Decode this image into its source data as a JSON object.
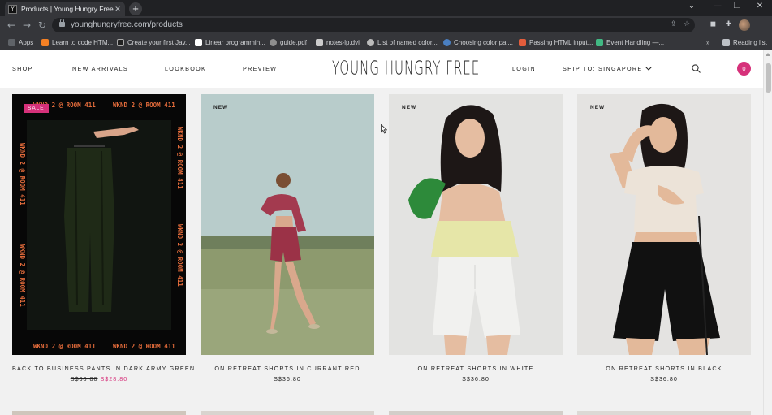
{
  "browser": {
    "tab_title": "Products | Young Hungry Free",
    "tab_close": "✕",
    "new_tab": "+",
    "url": "younghungryfree.com/products",
    "window_controls": [
      "⌄",
      "—",
      "❐",
      "✕"
    ],
    "bookmarks": [
      {
        "label": "Apps",
        "color": "#5f6368"
      },
      {
        "label": "Learn to code HTM...",
        "color": "#f48024"
      },
      {
        "label": "Create your first Jav...",
        "color": "#222222"
      },
      {
        "label": "Linear programmin...",
        "color": "#ffffff"
      },
      {
        "label": "guide.pdf",
        "color": "#8e8e8e"
      },
      {
        "label": "notes-lp.dvi",
        "color": "#cccccc"
      },
      {
        "label": "List of named color...",
        "color": "#bbbbbb"
      },
      {
        "label": "Choosing color pal...",
        "color": "#4a7fc1"
      },
      {
        "label": "Passing HTML input...",
        "color": "#e35d3c"
      },
      {
        "label": "Event Handling —...",
        "color": "#41b883"
      },
      {
        "label": "Reading list",
        "color": "#bdc1c6"
      }
    ]
  },
  "header": {
    "nav_left": [
      "SHOP",
      "NEW ARRIVALS",
      "LOOKBOOK",
      "PREVIEW"
    ],
    "logo": "YOUNG HUNGRY FREE",
    "login": "LOGIN",
    "ship_to": "SHIP TO: SINGAPORE",
    "cart_count": "0",
    "accent_color": "#d6317a"
  },
  "products": [
    {
      "badge": "SALE",
      "name": "BACK TO BUSINESS PANTS IN DARK ARMY GREEN",
      "old_price": "S$38.80",
      "price": "S$28.80"
    },
    {
      "badge": "NEW",
      "name": "ON RETREAT SHORTS IN CURRANT RED",
      "old_price": "",
      "price": "S$36.80"
    },
    {
      "badge": "NEW",
      "name": "ON RETREAT SHORTS IN WHITE",
      "old_price": "",
      "price": "S$36.80"
    },
    {
      "badge": "NEW",
      "name": "ON RETREAT SHORTS IN BLACK",
      "old_price": "",
      "price": "S$36.80"
    }
  ],
  "promo_text": "WKND 2 @ ROOM 411"
}
